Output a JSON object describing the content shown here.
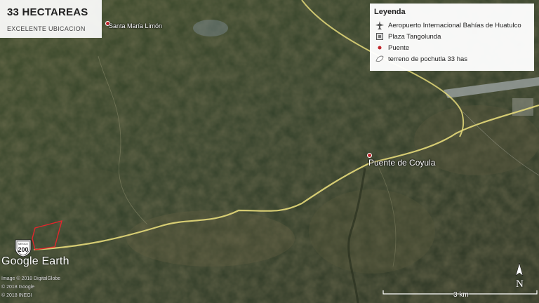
{
  "overlay": {
    "title": "33 HECTAREAS",
    "subtitle": "EXCELENTE UBICACION"
  },
  "legend": {
    "title": "Leyenda",
    "items": [
      {
        "icon": "airport-icon",
        "label": "Aeropuerto Internacional Bahías de Huatulco"
      },
      {
        "icon": "square-marker-icon",
        "label": "Plaza Tangolunda"
      },
      {
        "icon": "red-dot-icon",
        "label": "Puente"
      },
      {
        "icon": "polygon-icon",
        "label": "terreno de pochutla 33 has"
      }
    ]
  },
  "places": {
    "santa_maria": "Santa María Limón",
    "puente": "Puente de Coyula"
  },
  "shield": {
    "top": "MEXICO",
    "number": "200"
  },
  "branding": {
    "logo": "Google Earth",
    "credits": [
      "Image © 2018 DigitalGlobe",
      "© 2018 Google",
      "© 2018 INEGI"
    ]
  },
  "scale": "3 km",
  "north": "N",
  "colors": {
    "road": "#e4d97a",
    "parcel": "#e3262c",
    "pin": "#c0262c"
  }
}
